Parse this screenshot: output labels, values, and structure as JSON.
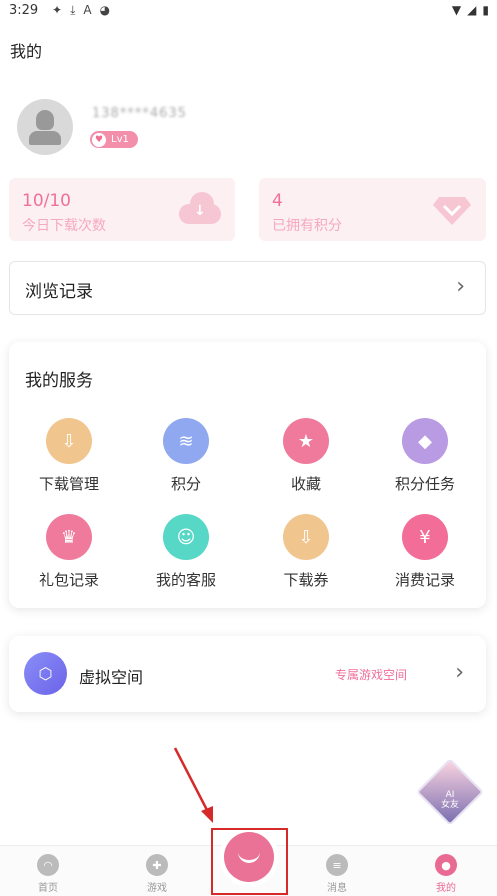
{
  "status_bar": {
    "time": "3:29",
    "left_icons": [
      "game-controller-icon",
      "download-icon",
      "a-icon",
      "pacman-icon"
    ],
    "right_icons": [
      "wifi-icon",
      "signal-icon",
      "battery-icon"
    ]
  },
  "page": {
    "title": "我的"
  },
  "profile": {
    "username": "138****4635",
    "level": "Lv1"
  },
  "stats": [
    {
      "value": "10/10",
      "label": "今日下载次数",
      "icon": "cloud-download-icon"
    },
    {
      "value": "4",
      "label": "已拥有积分",
      "icon": "diamond-icon"
    }
  ],
  "browse": {
    "label": "浏览记录"
  },
  "services": {
    "title": "我的服务",
    "items": [
      {
        "label": "下载管理",
        "icon": "download-icon",
        "color": "#f0c58e",
        "glyph": "⇩"
      },
      {
        "label": "积分",
        "icon": "coins-icon",
        "color": "#8fa8ef",
        "glyph": "≋"
      },
      {
        "label": "收藏",
        "icon": "folder-star-icon",
        "color": "#f07a9c",
        "glyph": "★"
      },
      {
        "label": "积分任务",
        "icon": "diamond-task-icon",
        "color": "#b99be3",
        "glyph": "◆"
      },
      {
        "label": "礼包记录",
        "icon": "gift-basket-icon",
        "color": "#f07a9c",
        "glyph": "♛"
      },
      {
        "label": "我的客服",
        "icon": "chat-icon",
        "color": "#57d7c6",
        "glyph": "☺"
      },
      {
        "label": "下载券",
        "icon": "download-coupon-icon",
        "color": "#f0c58e",
        "glyph": "⇩"
      },
      {
        "label": "消费记录",
        "icon": "receipt-icon",
        "color": "#f26d97",
        "glyph": "¥"
      }
    ]
  },
  "virtual_space": {
    "label": "虚拟空间",
    "subtitle": "专属游戏空间"
  },
  "floating_badge": {
    "line1": "AI",
    "line2": "女友"
  },
  "tabs": [
    {
      "label": "首页",
      "icon": "ghost-icon"
    },
    {
      "label": "游戏",
      "icon": "gamepad-icon"
    },
    {
      "label": "",
      "icon": "smile-center-icon"
    },
    {
      "label": "消息",
      "icon": "message-icon"
    },
    {
      "label": "我的",
      "icon": "user-icon"
    }
  ],
  "colors": {
    "accent": "#f0709a",
    "annotation": "#d62a2a"
  }
}
